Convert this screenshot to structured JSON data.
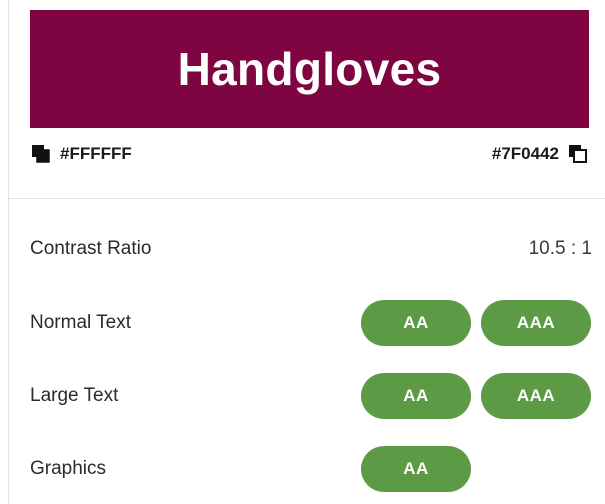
{
  "preview": {
    "text": "Handgloves"
  },
  "colors": {
    "foreground": "#FFFFFF",
    "background": "#7F0442",
    "pass_badge": "#5C9A45"
  },
  "swatches": {
    "foreground_label": "#FFFFFF",
    "background_label": "#7F0442",
    "foreground_icon": "copy-icon",
    "background_icon": "copy-icon"
  },
  "contrast": {
    "label": "Contrast Ratio",
    "value": "10.5 : 1"
  },
  "rows": [
    {
      "label": "Normal Text",
      "badges": [
        "AA",
        "AAA"
      ]
    },
    {
      "label": "Large Text",
      "badges": [
        "AA",
        "AAA"
      ]
    },
    {
      "label": "Graphics",
      "badges": [
        "AA"
      ]
    }
  ]
}
